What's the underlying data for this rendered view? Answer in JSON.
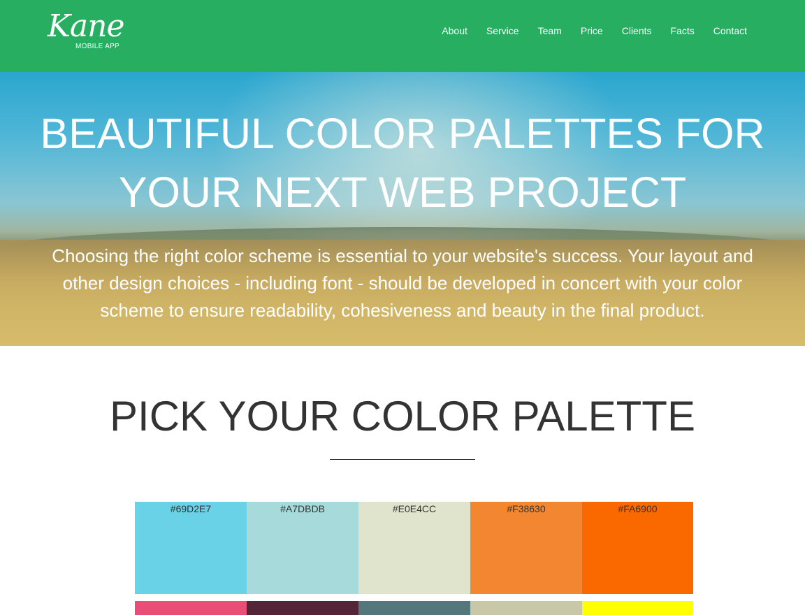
{
  "header": {
    "logo_script": "Kane",
    "logo_sub": "MOBILE APP",
    "bg_color": "#27ae60",
    "nav": [
      "About",
      "Service",
      "Team",
      "Price",
      "Clients",
      "Facts",
      "Contact"
    ]
  },
  "hero": {
    "title_line1": "BEAUTIFUL COLOR PALETTES FOR",
    "title_line2": "YOUR NEXT WEB PROJECT",
    "text": "Choosing the right color scheme is essential to your website's success. Your layout and other design choices - including font - should be developed in concert with your color scheme to ensure readability, cohesiveness and beauty in the final product."
  },
  "section": {
    "title": "PICK YOUR COLOR PALETTE"
  },
  "palette": {
    "row1": [
      {
        "label": "#69D2E7",
        "color": "#69D2E7"
      },
      {
        "label": "#A7DBDB",
        "color": "#A7DBDB"
      },
      {
        "label": "#E0E4CC",
        "color": "#E0E4CC"
      },
      {
        "label": "#F38630",
        "color": "#F38630"
      },
      {
        "label": "#FA6900",
        "color": "#FA6900"
      }
    ],
    "row2": [
      {
        "color": "#E94E77"
      },
      {
        "color": "#542437"
      },
      {
        "color": "#53777A"
      },
      {
        "color": "#C8C8A9"
      },
      {
        "color": "#FFFF00"
      }
    ]
  }
}
